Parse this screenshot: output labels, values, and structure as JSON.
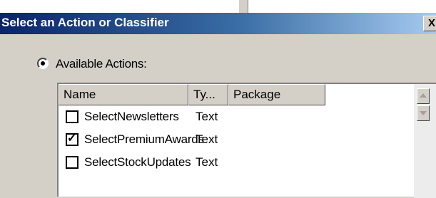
{
  "dialog": {
    "title": "Select an Action or Classifier",
    "close_label": "X"
  },
  "options": {
    "available_actions": {
      "label": "Available Actions:",
      "selected": true
    }
  },
  "table": {
    "columns": [
      "Name",
      "Ty...",
      "Package"
    ],
    "rows": [
      {
        "name": "SelectNewsletters",
        "type": "Text",
        "package": "",
        "checked": false
      },
      {
        "name": "SelectPremiumAwards",
        "type": "Text",
        "package": "",
        "checked": true
      },
      {
        "name": "SelectStockUpdates",
        "type": "Text",
        "package": "",
        "checked": false
      }
    ]
  },
  "icons": {
    "close": "close-icon",
    "radio": "radio-selected-icon",
    "scroll_up": "arrow-up-icon",
    "scroll_down": "arrow-down-icon",
    "check": "checkmark-icon"
  },
  "colors": {
    "titlebar_start": "#0a246a",
    "titlebar_end": "#a6caf0",
    "window_face": "#d4d0c8"
  }
}
